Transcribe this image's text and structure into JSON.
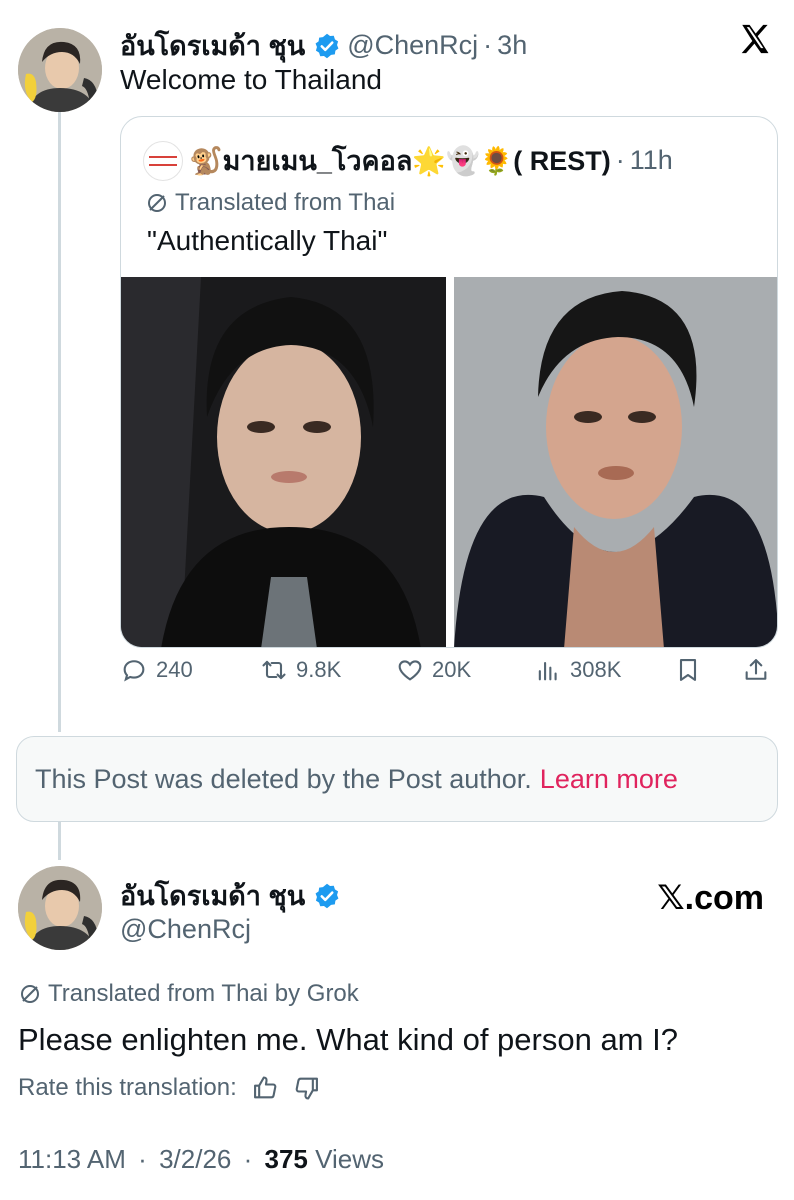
{
  "top_post": {
    "display_name": "อันโดรเมด้า ชุน",
    "handle": "@ChenRcj",
    "time": "3h",
    "text": "Welcome to Thailand"
  },
  "quoted_post": {
    "display_name": "🐒มายเมน_โวคอล🌟👻🌻( REST)",
    "time": "11h",
    "translated_label": "Translated from Thai",
    "text": "\"Authentically Thai\""
  },
  "actions": {
    "replies": "240",
    "reposts": "9.8K",
    "likes": "20K",
    "views": "308K"
  },
  "deleted_notice": {
    "text": "This Post was deleted by the Post author.",
    "link": "Learn more"
  },
  "main_post": {
    "display_name": "อันโดรเมด้า ชุน",
    "handle": "@ChenRcj",
    "watermark": "𝕏.com",
    "translated_label": "Translated from Thai by Grok",
    "text": "Please enlighten me. What kind of person am I?",
    "rate_label": "Rate this translation:",
    "time": "11:13 AM",
    "date": "3/2/26",
    "views_count": "375",
    "views_label": "Views"
  },
  "separator": "·",
  "colors": {
    "text": "#0f1419",
    "secondary": "#536471",
    "verified": "#1d9bf0",
    "link": "#e0245e",
    "border": "#cfd9de"
  }
}
